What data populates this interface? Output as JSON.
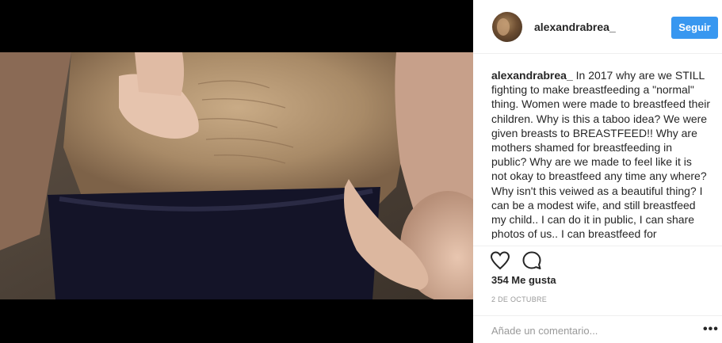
{
  "post": {
    "username": "alexandrabrea_",
    "follow_label": "Seguir",
    "caption_user": "alexandrabrea_",
    "caption_text": " In 2017 why are we STILL fighting to make breastfeeding a \"normal\" thing. Women were made to breastfeed their children. Why is this a taboo idea? We were given breasts to BREASTFEED!! Why are mothers shamed for breastfeeding in public? Why are we made to feel like it is not okay to breastfeed any time any where? Why isn't this veiwed as a beautiful thing? I can be a modest wife, and still breastfeed my child.. I can do it in public, I can share photos of us.. I can breastfeed for",
    "likes_label": "354 Me gusta",
    "date_label": "2 DE OCTUBRE",
    "comment_placeholder": "Añade un comentario...",
    "more_label": "•••"
  },
  "icons": {
    "like": "heart-icon",
    "comment": "comment-icon",
    "more": "more-options-icon"
  },
  "colors": {
    "accent": "#3897f0",
    "text": "#262626",
    "muted": "#999999",
    "divider": "#efefef"
  }
}
